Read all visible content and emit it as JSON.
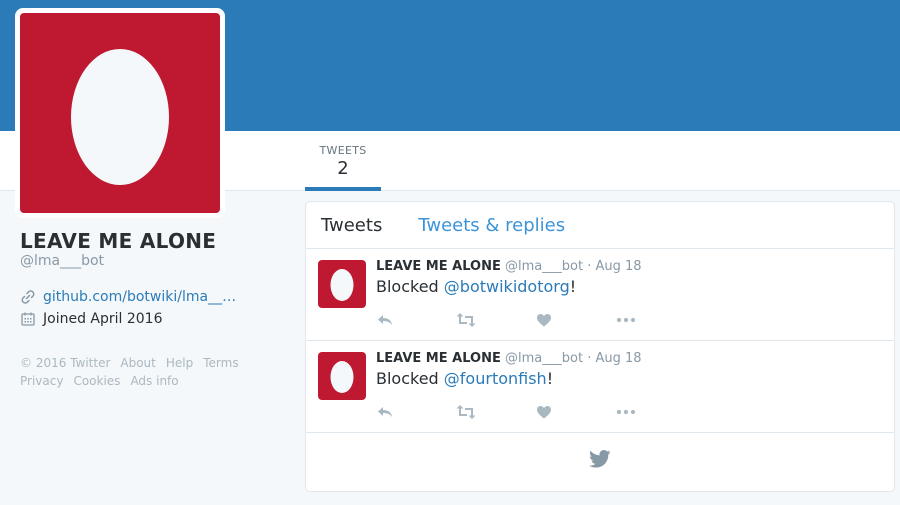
{
  "colors": {
    "banner": "#2b7bb9",
    "avatar_bg": "#be1931",
    "link": "#2b7bb9",
    "muted": "#8899a6",
    "action_icon": "#aab8c2"
  },
  "nav": {
    "tweets_label": "TWEETS",
    "tweets_count": "2"
  },
  "profile": {
    "name": "LEAVE ME ALONE",
    "handle": "@lma___bot",
    "link": "github.com/botwiki/lma___bot",
    "link_icon": "link-icon",
    "joined": "Joined April 2016",
    "joined_icon": "calendar-icon"
  },
  "footer": {
    "copyright": "© 2016 Twitter",
    "about": "About",
    "help": "Help",
    "terms": "Terms",
    "privacy": "Privacy",
    "cookies": "Cookies",
    "ads_info": "Ads info"
  },
  "timeline": {
    "tab_tweets": "Tweets",
    "tab_replies": "Tweets & replies",
    "end_icon": "twitter-bird-icon",
    "tweets": [
      {
        "name": "LEAVE ME ALONE",
        "handle": "@lma___bot",
        "separator": "·",
        "date": "Aug 18",
        "text_prefix": "Blocked ",
        "mention": "@botwikidotorg",
        "text_suffix": "!"
      },
      {
        "name": "LEAVE ME ALONE",
        "handle": "@lma___bot",
        "separator": "·",
        "date": "Aug 18",
        "text_prefix": "Blocked ",
        "mention": "@fourtonfish",
        "text_suffix": "!"
      }
    ],
    "action_icons": [
      "reply-icon",
      "retweet-icon",
      "like-icon",
      "more-icon"
    ]
  }
}
